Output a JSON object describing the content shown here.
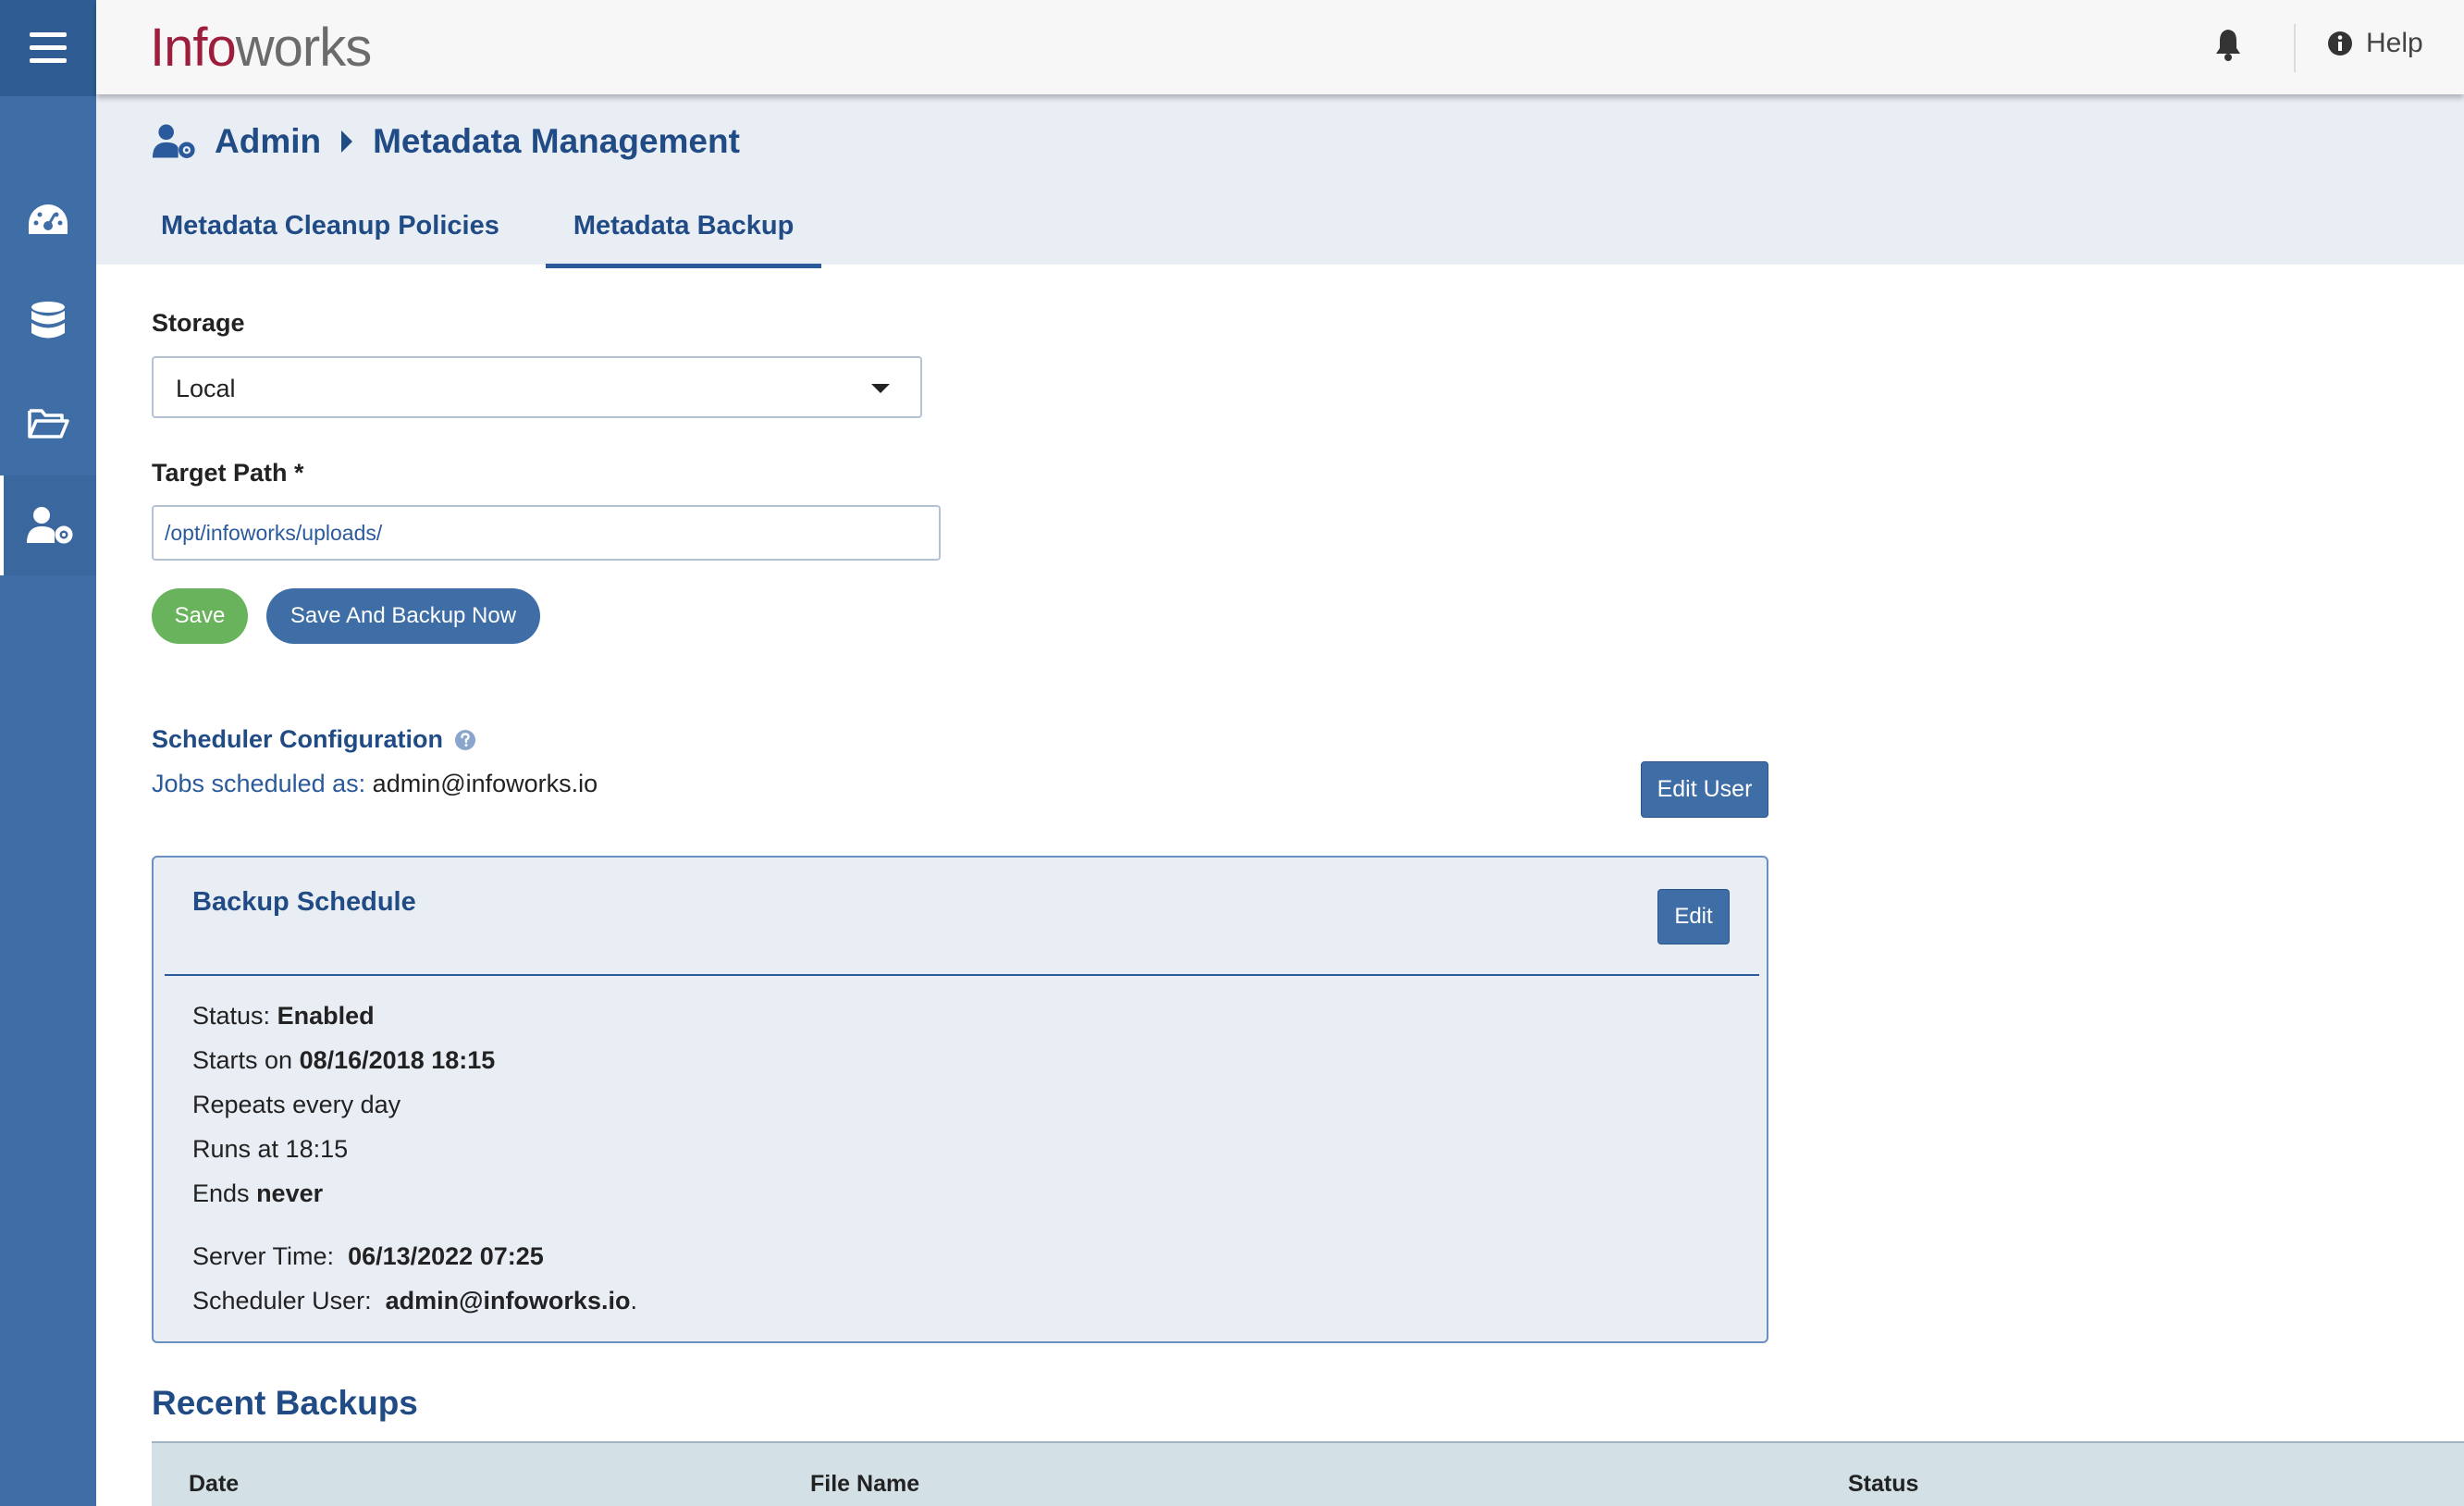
{
  "app": {
    "logo_part1": "Info",
    "logo_part2": "works"
  },
  "topbar": {
    "help_label": "Help"
  },
  "breadcrumb": {
    "root": "Admin",
    "current": "Metadata Management"
  },
  "tabs": [
    {
      "label": "Metadata Cleanup Policies",
      "active": false
    },
    {
      "label": "Metadata Backup",
      "active": true
    }
  ],
  "form": {
    "storage_label": "Storage",
    "storage_value": "Local",
    "target_label": "Target Path *",
    "target_value": "/opt/infoworks/uploads/",
    "save_label": "Save",
    "save_backup_label": "Save And Backup Now"
  },
  "scheduler": {
    "title": "Scheduler Configuration",
    "jobs_key": "Jobs scheduled as:",
    "jobs_value": "admin@infoworks.io",
    "edit_user_label": "Edit User"
  },
  "schedule": {
    "title": "Backup Schedule",
    "edit_label": "Edit",
    "status_key": "Status:",
    "status_value": "Enabled",
    "starts_key": "Starts on",
    "starts_value": "08/16/2018 18:15",
    "repeats": "Repeats every day",
    "runs": "Runs at 18:15",
    "ends_key": "Ends",
    "ends_value": "never",
    "server_time_key": "Server Time:",
    "server_time_value": "06/13/2022 07:25",
    "scheduler_user_key": "Scheduler User:",
    "scheduler_user_value": "admin@infoworks.io",
    "scheduler_user_suffix": "."
  },
  "recent": {
    "title": "Recent Backups",
    "columns": [
      "Date",
      "File Name",
      "Status"
    ]
  },
  "colors": {
    "primary": "#3f6ea6",
    "accent_dark": "#214b85",
    "success": "#69b35c",
    "brand": "#9c1d3c"
  },
  "icons": [
    "menu-icon",
    "dashboard-icon",
    "database-icon",
    "folder-icon",
    "user-gear-icon",
    "bell-icon",
    "info-icon",
    "chevron-right-icon",
    "caret-down-icon",
    "question-icon"
  ]
}
